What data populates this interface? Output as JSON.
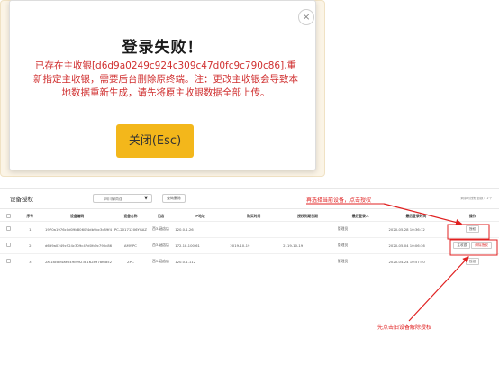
{
  "dialog": {
    "close_symbol": "×",
    "title": "登录失败！",
    "message": "已存在主收银[d6d9a0249c924c309c47d0fc9c790c86],重新指定主收银，需要后台删除原终端。注：更改主收银会导致本地数据重新生成，请先将原主收银数据全部上传。",
    "button": "关闭(Esc)"
  },
  "panel": {
    "title": "设备授权",
    "select_value": "四川绿尚连",
    "button": "查询删除",
    "right_text": "剩余可授权台数：1个",
    "columns": [
      "",
      "序号",
      "设备编码",
      "设备名称",
      "门店",
      "IP地址",
      "购买时间",
      "授权到期日期",
      "最后登录人",
      "最后登录时间",
      "操作"
    ],
    "rows": [
      {
        "seq": "1",
        "code": "1970a1976c0d09b8060f4db9bc3c89f4",
        "name": "PC-20171206YGAZ",
        "store": "西3-涵店店",
        "ip": "120.0.1.26",
        "buy": "",
        "expire": "",
        "user": "管理员",
        "time": "2020-05-28 10:36:12",
        "ops": [
          "授权"
        ]
      },
      {
        "seq": "2",
        "code": "d6d9a0249c924c309c47d0fc9c790c86",
        "name": "AMY-PC",
        "store": "西3-涵店店",
        "ip": "172.18.100.61",
        "buy": "2019-10-19",
        "expire": "2119-10-19",
        "user": "管理员",
        "time": "2020-05-04 10:06:36",
        "ops": [
          "主收银",
          "解除授权"
        ]
      },
      {
        "seq": "3",
        "code": "2af18c894ae549c09238162897afba52",
        "name": "ZPC",
        "store": "西3-涵店店",
        "ip": "120.0.1.112",
        "buy": "",
        "expire": "",
        "user": "管理员",
        "time": "2020-04-24 10:57:50",
        "ops": [
          "授权"
        ]
      }
    ]
  },
  "annotations": {
    "top": "再选择当前设备，点击授权",
    "bottom": "先点击旧设备解除授权"
  },
  "colors": {
    "accent": "#f3b71b",
    "error": "#d03030",
    "annotation": "#e02020"
  }
}
